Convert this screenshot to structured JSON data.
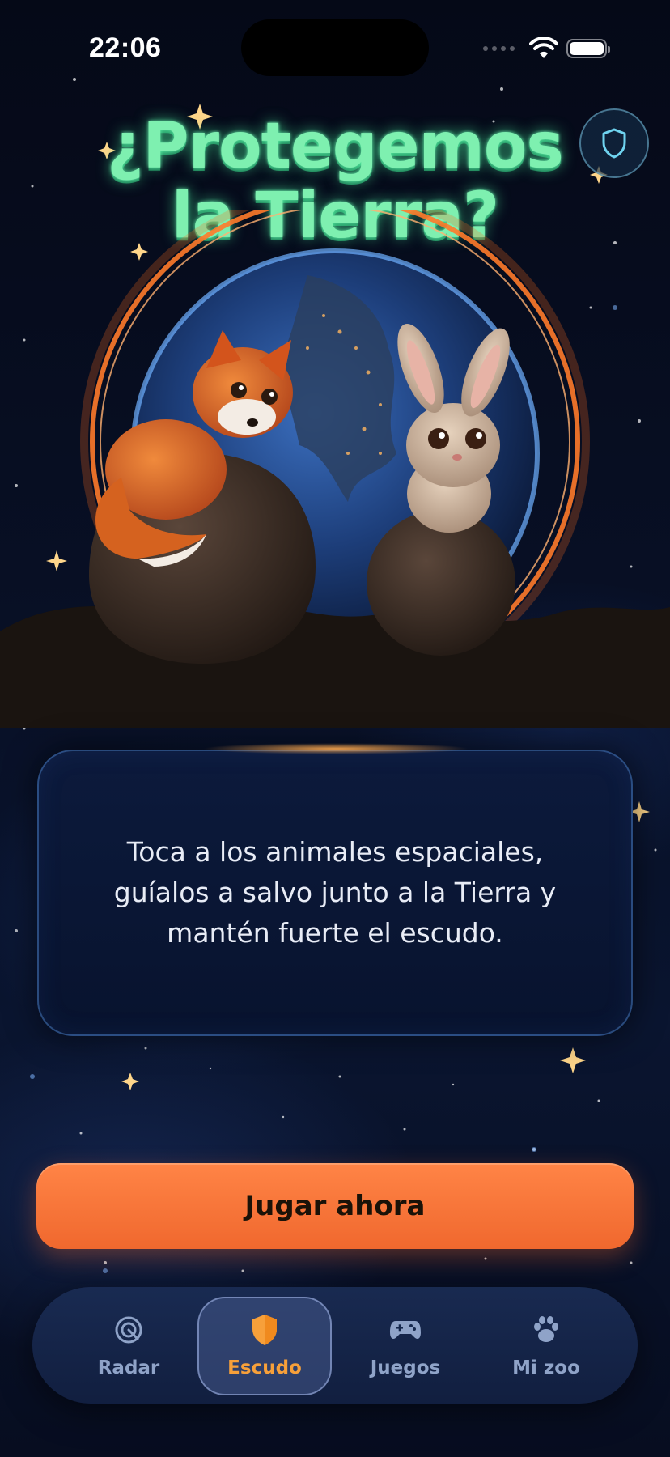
{
  "status_bar": {
    "time": "22:06"
  },
  "header": {
    "title_line1": "¿Protegemos",
    "title_line2": "la Tierra?",
    "shield_icon": "shield-icon"
  },
  "card": {
    "text": "Toca a los animales espaciales, guíalos a salvo junto a la Tierra y mantén fuerte el escudo."
  },
  "cta": {
    "label": "Jugar ahora"
  },
  "tabs": [
    {
      "label": "Radar",
      "icon": "radar-icon",
      "active": false
    },
    {
      "label": "Escudo",
      "icon": "shield-icon",
      "active": true
    },
    {
      "label": "Juegos",
      "icon": "gamepad-icon",
      "active": false
    },
    {
      "label": "Mi zoo",
      "icon": "paw-icon",
      "active": false
    }
  ],
  "colors": {
    "title_green": "#7ef0b0",
    "cta_orange": "#f0682e",
    "active_tab_orange": "#f7a03a",
    "inactive_tab": "#8fa3c8",
    "background": "#060b1c"
  }
}
